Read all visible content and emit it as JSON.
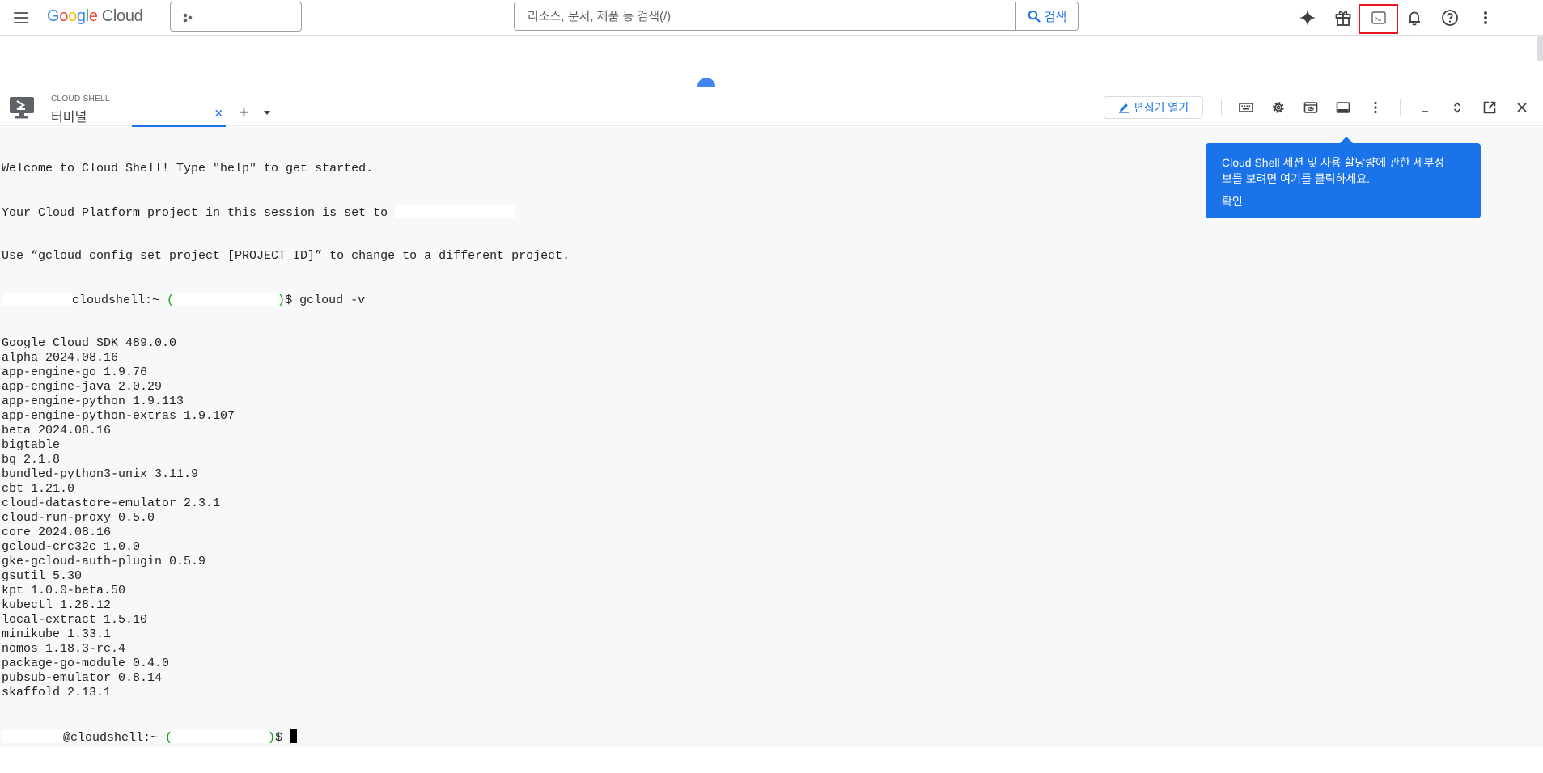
{
  "topbar": {
    "logo": {
      "g": "G",
      "o1": "o",
      "o2": "o",
      "g2": "g",
      "l": "l",
      "e": "e",
      "cloud": "Cloud"
    },
    "search": {
      "placeholder": "리소스, 문서, 제품 등 검색(/)",
      "button_label": "검색"
    },
    "icons": [
      "menu-icon",
      "project-picker-icon",
      "gemini-sparkle-icon",
      "gift-icon",
      "cloud-shell-terminal-icon",
      "notifications-bell-icon",
      "help-icon",
      "more-vert-icon"
    ]
  },
  "shell": {
    "kicker": "CLOUD SHELL",
    "tab_label": "터미널",
    "tab_close": "×",
    "tab_add": "+",
    "editor_button": "편집기 열기"
  },
  "terminal": {
    "welcome": "Welcome to Cloud Shell! Type \"help\" to get started.",
    "project_line": "Your Cloud Platform project in this session is set to ",
    "hint_line": "Use “gcloud config set project [PROJECT_ID]” to change to a different project.",
    "prompt1_host": "cloudshell:~ ",
    "prompt1_paren_open": "(",
    "prompt1_paren_close": ")",
    "prompt1_cmd": "$ gcloud -v",
    "output": [
      "Google Cloud SDK 489.0.0",
      "alpha 2024.08.16",
      "app-engine-go 1.9.76",
      "app-engine-java 2.0.29",
      "app-engine-python 1.9.113",
      "app-engine-python-extras 1.9.107",
      "beta 2024.08.16",
      "bigtable",
      "bq 2.1.8",
      "bundled-python3-unix 3.11.9",
      "cbt 1.21.0",
      "cloud-datastore-emulator 2.3.1",
      "cloud-run-proxy 0.5.0",
      "core 2024.08.16",
      "gcloud-crc32c 1.0.0",
      "gke-gcloud-auth-plugin 0.5.9",
      "gsutil 5.30",
      "kpt 1.0.0-beta.50",
      "kubectl 1.28.12",
      "local-extract 1.5.10",
      "minikube 1.33.1",
      "nomos 1.18.3-rc.4",
      "package-go-module 0.4.0",
      "pubsub-emulator 0.8.14",
      "skaffold 2.13.1"
    ],
    "prompt2_host": "@cloudshell:~ ",
    "prompt2_paren_open": "(",
    "prompt2_paren_close": ")",
    "prompt2_dollar": "$ "
  },
  "tooltip": {
    "line1": "Cloud Shell 세션 및 사용 할당량에 관한 세부정",
    "line2": "보를 보려면 여기를 클릭하세요.",
    "ok": "확인"
  },
  "colors": {
    "accent": "#1a73e8",
    "highlight_border": "#e8141d",
    "prompt_green": "#13a10e",
    "terminal_bg": "#f8f8f8"
  }
}
